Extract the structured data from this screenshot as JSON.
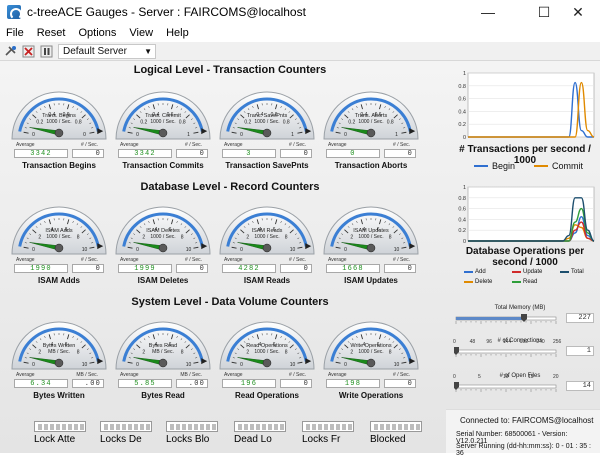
{
  "window": {
    "title": "c-treeACE Gauges - Server : FAIRCOMS@localhost",
    "icon": "app-icon"
  },
  "menu": [
    {
      "label": "File"
    },
    {
      "label": "Reset"
    },
    {
      "label": "Options"
    },
    {
      "label": "View"
    },
    {
      "label": "Help"
    }
  ],
  "toolbar": {
    "server_value": "Default Server",
    "icons": [
      "connect-icon",
      "disconnect-icon",
      "pause-icon"
    ]
  },
  "sections": {
    "transaction": "Logical Level - Transaction Counters",
    "record": "Database Level - Record Counters",
    "volume": "System Level - Data Volume Counters"
  },
  "common": {
    "average": "Average",
    "per_sec": "# / Sec.",
    "mb_per_sec": "MB / Sec."
  },
  "gauges": [
    {
      "id": "trans-begins",
      "face_line1": "Trans. Begins",
      "face_line2": "1000 / Sec.",
      "ticks": [
        "0.2",
        "0.4",
        "0.6",
        "0.8"
      ],
      "tick_end": "0",
      "tick_start": "0",
      "avg": "3342",
      "rate": "0",
      "label": "Transaction Begins",
      "avg_color": "green",
      "needle": 0.0
    },
    {
      "id": "trans-commits",
      "face_line1": "Trans. Commit",
      "face_line2": "1000 / Sec.",
      "ticks": [
        "0.2",
        "0.4",
        "0.6",
        "0.8"
      ],
      "tick_end": "1",
      "tick_start": "0",
      "avg": "3342",
      "rate": "0",
      "label": "Transaction Commits",
      "avg_color": "green",
      "needle": 0.0
    },
    {
      "id": "trans-savepoints",
      "face_line1": "Tranc. SavePnts",
      "face_line2": "1000 / Sec.",
      "ticks": [
        "0.2",
        "0.4",
        "0.6",
        "0.8"
      ],
      "tick_end": "1",
      "tick_start": "0",
      "avg": "3",
      "rate": "0",
      "label": "Transaction SavePnts",
      "avg_color": "green",
      "needle": 0.0
    },
    {
      "id": "trans-aborts",
      "face_line1": "Trans. Aborts",
      "face_line2": "1000 / Sec.",
      "ticks": [
        "0.2",
        "0.4",
        "0.6",
        "0.8"
      ],
      "tick_end": "1",
      "tick_start": "0",
      "avg": "0",
      "rate": "0",
      "label": "Transaction Aborts",
      "avg_color": "green",
      "needle": 0.0
    },
    {
      "id": "isam-adds",
      "face_line1": "ISAM Adds",
      "face_line2": "1000 / Sec.",
      "ticks": [
        "2",
        "4",
        "6",
        "8"
      ],
      "tick_end": "10",
      "tick_start": "0",
      "avg": "1990",
      "rate": "0",
      "label": "ISAM Adds",
      "avg_color": "green",
      "needle": 0.0
    },
    {
      "id": "isam-deletes",
      "face_line1": "ISAM Deletes",
      "face_line2": "1000 / Sec.",
      "ticks": [
        "2",
        "4",
        "6",
        "8"
      ],
      "tick_end": "10",
      "tick_start": "0",
      "avg": "1999",
      "rate": "0",
      "label": "ISAM Deletes",
      "avg_color": "green",
      "needle": 0.0
    },
    {
      "id": "isam-reads",
      "face_line1": "ISAM Reads",
      "face_line2": "1000 / Sec.",
      "ticks": [
        "2",
        "4",
        "6",
        "8"
      ],
      "tick_end": "10",
      "tick_start": "0",
      "avg": "4282",
      "rate": "0",
      "label": "ISAM Reads",
      "avg_color": "green",
      "needle": 0.0
    },
    {
      "id": "isam-updates",
      "face_line1": "ISAM Updates",
      "face_line2": "1000 / Sec.",
      "ticks": [
        "2",
        "4",
        "6",
        "8"
      ],
      "tick_end": "10",
      "tick_start": "0",
      "avg": "1668",
      "rate": "0",
      "label": "ISAM Updates",
      "avg_color": "green",
      "needle": 0.0
    },
    {
      "id": "bytes-written",
      "face_line1": "Bytes Written",
      "face_line2": "MB / Sec.",
      "ticks": [
        "2",
        "4",
        "6",
        "8"
      ],
      "tick_end": "10",
      "tick_start": "0",
      "avg": "6.34",
      "rate": ".00",
      "label": "Bytes Written",
      "avg_color": "green",
      "needle": 0.0
    },
    {
      "id": "bytes-read",
      "face_line1": "Bytes Read",
      "face_line2": "MB / Sec.",
      "ticks": [
        "2",
        "4",
        "6",
        "8"
      ],
      "tick_end": "10",
      "tick_start": "0",
      "avg": "5.85",
      "rate": ".00",
      "label": "Bytes Read",
      "avg_color": "green",
      "needle": 0.0
    },
    {
      "id": "read-operations",
      "face_line1": "Read Operations",
      "face_line2": "1000 / Sec.",
      "ticks": [
        "2",
        "4",
        "6",
        "8"
      ],
      "tick_end": "10",
      "tick_start": "0",
      "avg": "196",
      "rate": "0",
      "label": "Read Operations",
      "avg_color": "green",
      "needle": 0.0
    },
    {
      "id": "write-operations",
      "face_line1": "Write Operations",
      "face_line2": "1000 / Sec.",
      "ticks": [
        "2",
        "4",
        "6",
        "8"
      ],
      "tick_end": "10",
      "tick_start": "0",
      "avg": "198",
      "rate": "0",
      "label": "Write Operations",
      "avg_color": "green",
      "needle": 0.0
    }
  ],
  "chart_data": [
    {
      "type": "line",
      "title": "# Transactions per second / 1000",
      "ylim": [
        0,
        1
      ],
      "y_ticks": [
        "1",
        "0.8",
        "0.6",
        "0.4",
        "0.2",
        "0"
      ],
      "x": [
        0,
        1,
        2,
        3,
        4,
        5,
        6,
        7,
        8,
        9,
        10,
        11,
        12,
        13,
        14,
        15,
        16,
        17,
        18,
        19,
        20
      ],
      "series": [
        {
          "name": "Begin",
          "color": "#2f6fd0",
          "values": [
            0,
            0,
            0,
            0,
            0,
            0,
            0,
            0,
            0,
            0,
            0,
            0,
            0,
            0,
            0,
            0,
            0,
            0.85,
            0.1,
            0,
            0
          ]
        },
        {
          "name": "Commit",
          "color": "#e08a00",
          "values": [
            0,
            0,
            0,
            0,
            0,
            0,
            0,
            0,
            0,
            0,
            0,
            0,
            0,
            0,
            0,
            0,
            0,
            0,
            0.85,
            0.1,
            0
          ]
        }
      ],
      "grid": true,
      "legend": "bottom"
    },
    {
      "type": "line",
      "title": "Database Operations per second / 1000",
      "ylim": [
        0,
        1
      ],
      "y_ticks": [
        "1",
        "0.8",
        "0.6",
        "0.4",
        "0.2",
        "0"
      ],
      "x": [
        0,
        1,
        2,
        3,
        4,
        5,
        6,
        7,
        8,
        9,
        10,
        11,
        12,
        13,
        14,
        15,
        16,
        17,
        18,
        19,
        20
      ],
      "series": [
        {
          "name": "Add",
          "color": "#2f6fd0",
          "values": [
            0,
            0,
            0,
            0,
            0,
            0,
            0,
            0,
            0,
            0,
            0,
            0,
            0,
            0,
            0,
            0,
            0,
            0.15,
            0.45,
            0.1,
            0
          ]
        },
        {
          "name": "Delete",
          "color": "#e08a00",
          "values": [
            0,
            0,
            0,
            0,
            0,
            0,
            0,
            0,
            0,
            0,
            0,
            0,
            0,
            0,
            0,
            0,
            0.05,
            0.3,
            0.25,
            0.05,
            0
          ]
        },
        {
          "name": "Update",
          "color": "#d02b2b",
          "values": [
            0,
            0,
            0,
            0,
            0,
            0,
            0,
            0,
            0,
            0,
            0,
            0,
            0,
            0,
            0,
            0,
            0,
            0.2,
            0.35,
            0.05,
            0
          ]
        },
        {
          "name": "Read",
          "color": "#2e9e3a",
          "values": [
            0,
            0,
            0,
            0,
            0,
            0,
            0,
            0,
            0,
            0,
            0,
            0,
            0,
            0,
            0,
            0,
            0,
            0.35,
            0.6,
            0.15,
            0
          ]
        },
        {
          "name": "Total",
          "color": "#1d4f6e",
          "values": [
            0,
            0,
            0,
            0,
            0,
            0,
            0,
            0,
            0,
            0,
            0,
            0,
            0,
            0,
            0,
            0,
            0.1,
            0.8,
            0.8,
            0.2,
            0
          ]
        }
      ],
      "grid": true,
      "legend": "bottom"
    }
  ],
  "sliders": [
    {
      "id": "total-memory",
      "title": "Total Memory (MB)",
      "value": "227",
      "fraction": 0.68,
      "scale": [
        "",
        "",
        "",
        "",
        ""
      ]
    },
    {
      "id": "connections",
      "title": "# of Connections",
      "value": "1",
      "fraction": 0.0,
      "scale": [
        "0",
        "48",
        "96",
        "144",
        "192",
        "240",
        "256"
      ]
    },
    {
      "id": "open-files",
      "title": "# of Open Files",
      "value": "14",
      "fraction": 0.0,
      "scale": [
        "0",
        "5",
        "10",
        "15",
        "20"
      ]
    }
  ],
  "connection": {
    "connected_to": "Connected to: FAIRCOMS@localhost",
    "serial": "Serial Number: 68500061 - Version: V12.0.211",
    "running": "Server Running (dd-hh:mm:ss): 0 - 01 : 35 : 36"
  },
  "locks": [
    {
      "label": "Lock Atte"
    },
    {
      "label": "Locks De"
    },
    {
      "label": "Locks Blo"
    },
    {
      "label": "Dead Lo"
    },
    {
      "label": "Locks Fr"
    },
    {
      "label": "Blocked"
    }
  ],
  "colors": {
    "gauge_arc": "#3b7fd4",
    "needle": "#1a8a1a",
    "lcd_green": "#1f8f1f"
  }
}
